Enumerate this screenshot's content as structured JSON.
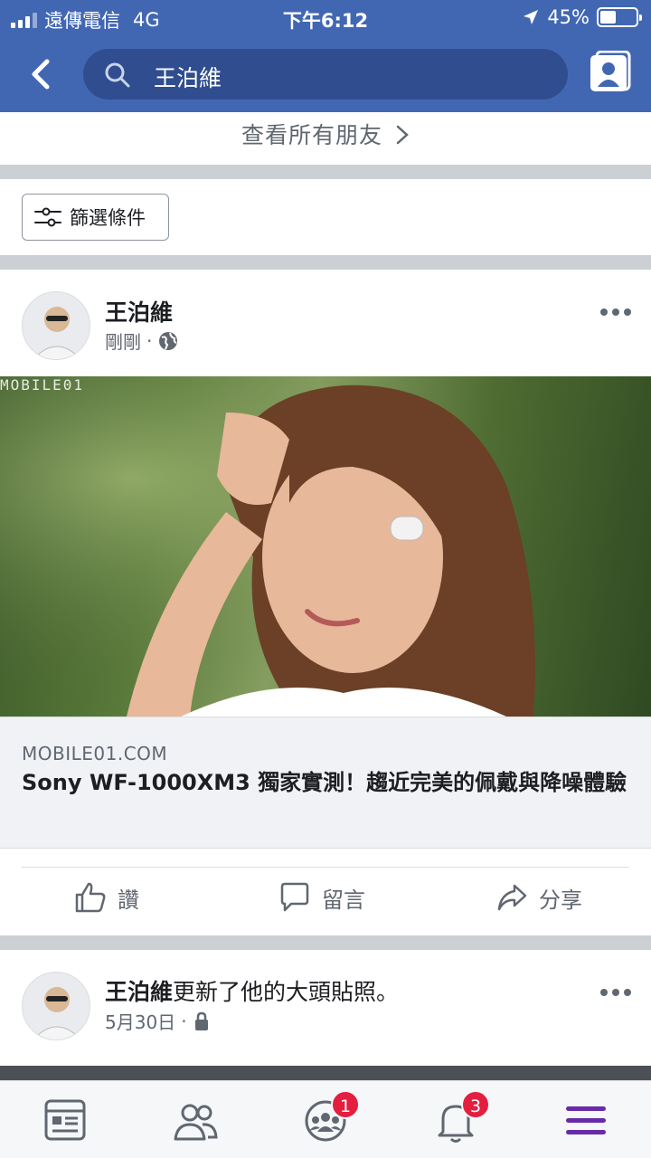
{
  "status_bar": {
    "carrier": "遠傳電信",
    "network": "4G",
    "time": "下午6:12",
    "battery_percent": "45%",
    "battery_level": 0.45
  },
  "header": {
    "search_query": "王泊維",
    "colors": {
      "bar": "#4267b2",
      "search_field": "#2f4d8f"
    }
  },
  "see_all_friends": "查看所有朋友",
  "filter_button": "篩選條件",
  "post": {
    "author": "王泊維",
    "time": "剛剛",
    "privacy_icon": "globe-icon",
    "watermark": "MOBILE01",
    "link": {
      "domain": "MOBILE01.COM",
      "title": "Sony WF-1000XM3 獨家實測！趨近完美的佩戴與降噪體驗"
    },
    "actions": {
      "like": "讚",
      "comment": "留言",
      "share": "分享"
    }
  },
  "post2": {
    "author": "王泊維",
    "text": "更新了他的大頭貼照。",
    "date": "5月30日",
    "privacy_icon": "lock-icon"
  },
  "tabbar": {
    "items": [
      {
        "name": "news-feed-icon"
      },
      {
        "name": "friends-icon"
      },
      {
        "name": "groups-icon",
        "badge": "1"
      },
      {
        "name": "notifications-icon",
        "badge": "3"
      },
      {
        "name": "menu-icon",
        "active": true
      }
    ],
    "badge_color": "#e41e3f",
    "active_color": "#6a2aa8"
  }
}
